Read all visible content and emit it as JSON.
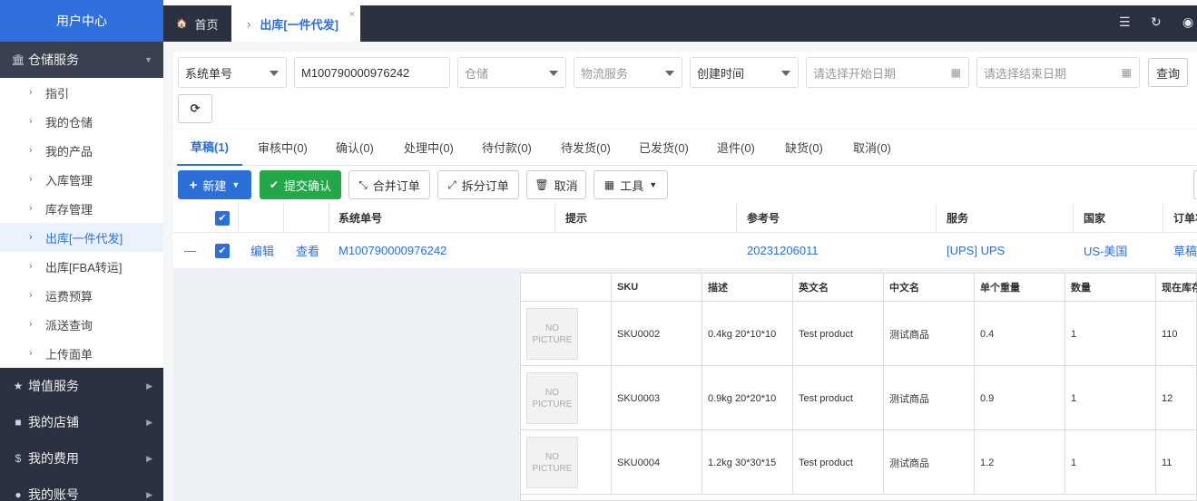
{
  "sidebar": {
    "brand": "用户中心",
    "groups": [
      {
        "label": "仓储服务"
      },
      {
        "label": "增值服务"
      },
      {
        "label": "我的店铺"
      },
      {
        "label": "我的费用"
      },
      {
        "label": "我的账号"
      }
    ],
    "items": [
      {
        "label": "指引"
      },
      {
        "label": "我的仓储"
      },
      {
        "label": "我的产品"
      },
      {
        "label": "入库管理"
      },
      {
        "label": "库存管理"
      },
      {
        "label": "出库[一件代发]"
      },
      {
        "label": "出库[FBA转运]"
      },
      {
        "label": "运费预算"
      },
      {
        "label": "派送查询"
      },
      {
        "label": "上传面单"
      }
    ]
  },
  "topbar": {
    "home_tab": "首页",
    "active_tab": "出库[一件代发]",
    "close": "×"
  },
  "filters": {
    "search_type": "系统单号",
    "search_value": "M100790000976242",
    "warehouse_placeholder": "仓储",
    "logistics_placeholder": "物流服务",
    "time_type": "创建时间",
    "start_placeholder": "请选择开始日期",
    "end_placeholder": "请选择结束日期",
    "query_label": "查询"
  },
  "status_tabs": [
    {
      "label": "草稿(1)"
    },
    {
      "label": "审核中(0)"
    },
    {
      "label": "确认(0)"
    },
    {
      "label": "处理中(0)"
    },
    {
      "label": "待付款(0)"
    },
    {
      "label": "待发货(0)"
    },
    {
      "label": "已发货(0)"
    },
    {
      "label": "退件(0)"
    },
    {
      "label": "缺货(0)"
    },
    {
      "label": "取消(0)"
    }
  ],
  "actions": {
    "new": "新建",
    "submit": "提交确认",
    "merge": "合并订单",
    "split": "拆分订单",
    "cancel": "取消",
    "tools": "工具"
  },
  "table": {
    "headers": {
      "system_no": "系统单号",
      "hint": "提示",
      "reference": "参考号",
      "service": "服务",
      "country": "国家",
      "order_status": "订单状"
    },
    "row": {
      "collapse": "—",
      "edit": "编辑",
      "view": "查看",
      "system_no": "M100790000976242",
      "reference": "20231206011",
      "service": "[UPS] UPS",
      "country": "US-美国",
      "status": "草稿"
    }
  },
  "sku_table": {
    "headers": [
      "SKU",
      "描述",
      "英文名",
      "中文名",
      "单个重量",
      "数量",
      "现在库存"
    ],
    "no_picture": [
      "NO",
      "PICTURE"
    ],
    "rows": [
      {
        "sku": "SKU0002",
        "desc": "0.4kg 20*10*10",
        "en": "Test product",
        "cn": "测试商品",
        "weight": "0.4",
        "qty": "1",
        "stock": "110"
      },
      {
        "sku": "SKU0003",
        "desc": "0.9kg 20*20*10",
        "en": "Test product",
        "cn": "测试商品",
        "weight": "0.9",
        "qty": "1",
        "stock": "12"
      },
      {
        "sku": "SKU0004",
        "desc": "1.2kg 30*30*15",
        "en": "Test product",
        "cn": "测试商品",
        "weight": "1.2",
        "qty": "1",
        "stock": "11"
      }
    ]
  }
}
